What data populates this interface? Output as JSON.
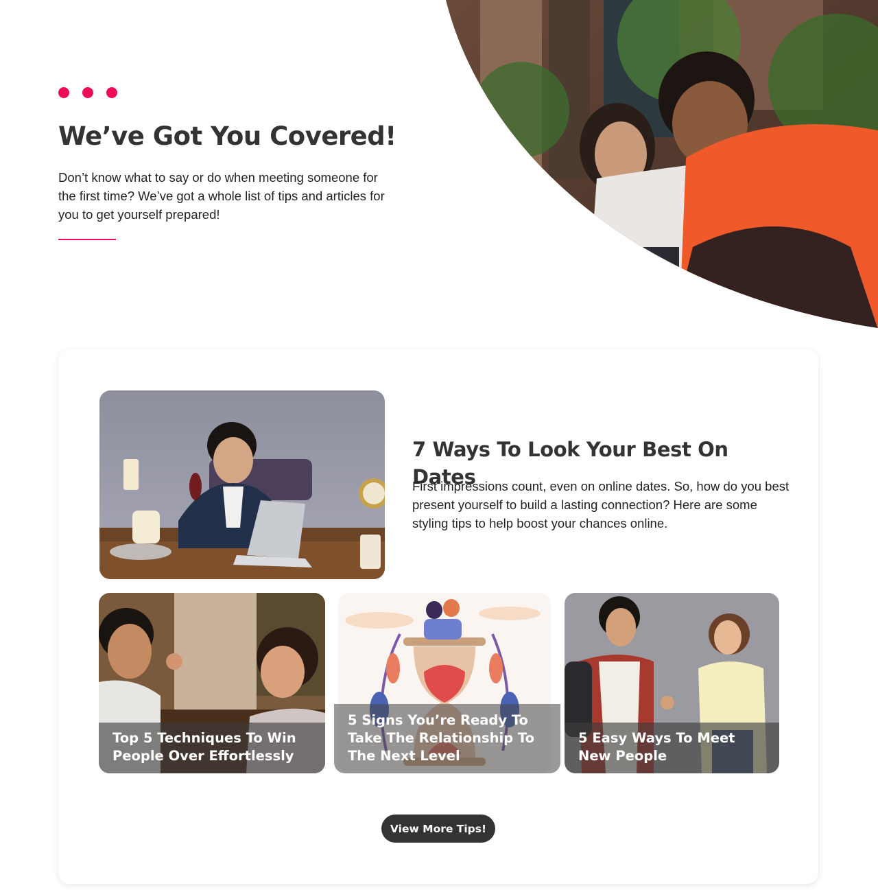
{
  "hero": {
    "title": "We’ve Got You Covered!",
    "text": "Don’t know what to say or do when meeting someone for the first time? We’ve got a whole list of tips and articles for you to get yourself prepared!",
    "accent_color": "#ec0c5a"
  },
  "featured": {
    "title": "7 Ways To Look Your Best On Dates",
    "text": "First impressions count, even on online dates. So, how do you best present yourself to build a lasting connection? Here are some styling tips to help boost your chances online."
  },
  "tiles": [
    {
      "caption": "Top 5 Techniques To Win People Over Effortlessly"
    },
    {
      "caption": "5 Signs You’re Ready To Take The Relationship To The Next Level"
    },
    {
      "caption": "5 Easy Ways To Meet New People"
    }
  ],
  "cta": {
    "label": "View More Tips!"
  }
}
